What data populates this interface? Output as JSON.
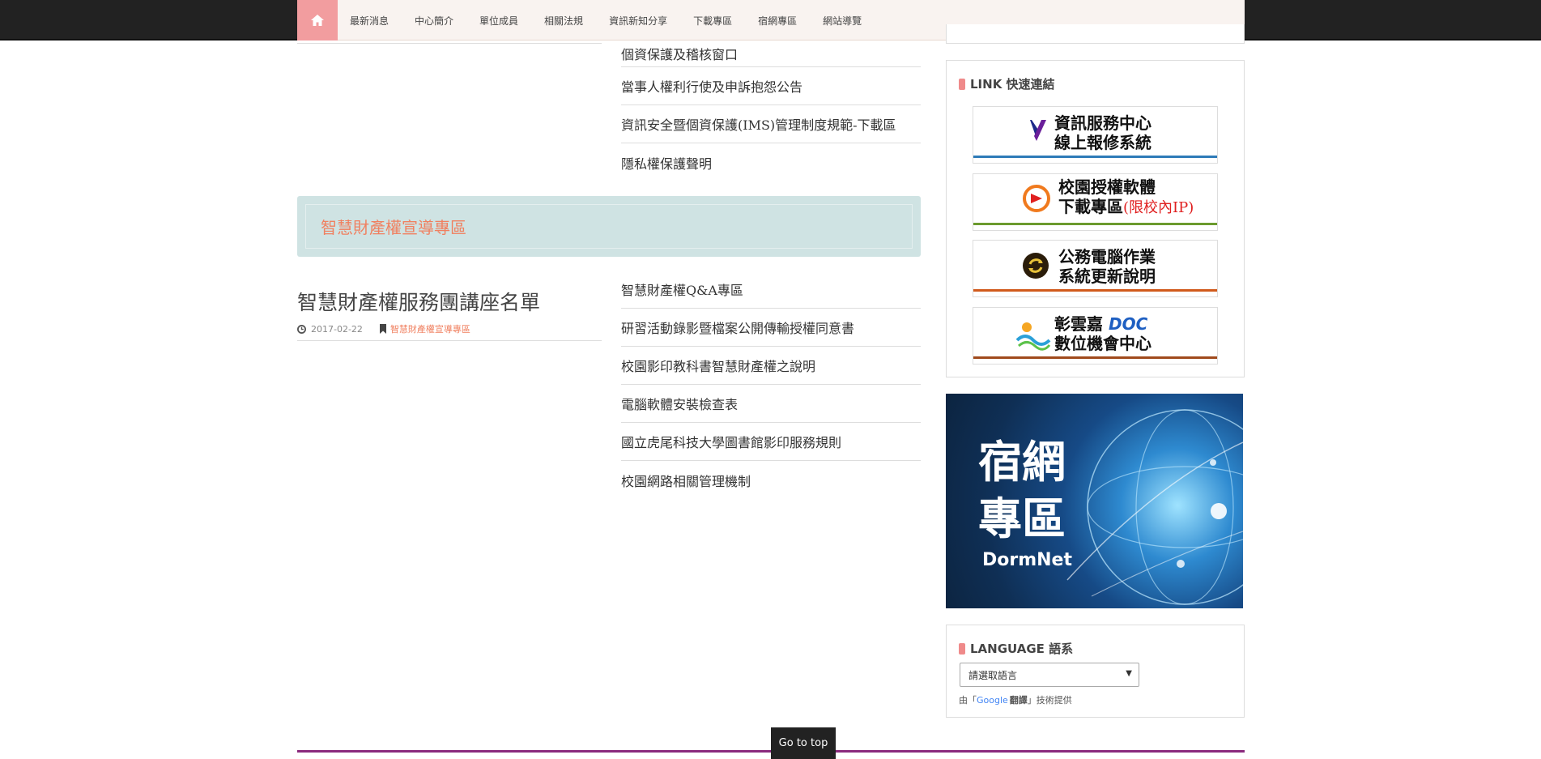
{
  "nav": {
    "home_icon": "home-icon",
    "items": [
      "最新消息",
      "中心簡介",
      "單位成員",
      "相關法規",
      "資訊新知分享",
      "下載專區",
      "宿網專區",
      "網站導覽"
    ]
  },
  "privacy_list": [
    "個資保護及稽核窗口",
    "當事人權利行使及申訴抱怨公告",
    "資訊安全暨個資保護(IMS)管理制度規範-下載區",
    "隱私權保護聲明"
  ],
  "ip_section": {
    "title": "智慧財產權宣導專區",
    "post": {
      "title": "智慧財產權服務團講座名單",
      "date": "2017-02-22",
      "category": "智慧財產權宣導專區"
    },
    "links": [
      "智慧財產權Q&A專區",
      "研習活動錄影暨檔案公開傳輸授權同意書",
      "校園影印教科書智慧財產權之說明",
      "電腦軟體安裝檢查表",
      "國立虎尾科技大學圖書館影印服務規則",
      "校園網路相關管理機制"
    ]
  },
  "sidebar": {
    "link_title": "LINK 快速連結",
    "links": [
      {
        "line1": "資訊服務中心",
        "line2": "線上報修系統",
        "extra": "",
        "strip": "#2e7bb8",
        "icon": "v-logo-icon"
      },
      {
        "line1": "校園授權軟體",
        "line2": "下載專區",
        "extra": "(限校內IP)",
        "strip": "#6b9a2e",
        "icon": "download-icon"
      },
      {
        "line1": "公務電腦作業",
        "line2": "系統更新說明",
        "extra": "",
        "strip": "#d15a1c",
        "icon": "refresh-icon"
      },
      {
        "line1": "彰雲嘉",
        "line2": "數位機會中心",
        "extra": "DOC",
        "strip": "#a04a1c",
        "icon": "doc-logo-icon"
      }
    ],
    "dorm": {
      "title1": "宿網",
      "title2": "專區",
      "subtitle": "DormNet"
    },
    "language_title": "LANGUAGE 語系",
    "select_value": "請選取語言",
    "powered_prefix": "由「",
    "powered_google": "Google",
    "powered_translate": "翻譯",
    "powered_suffix": "」技術提供"
  },
  "go_to_top": "Go to top"
}
